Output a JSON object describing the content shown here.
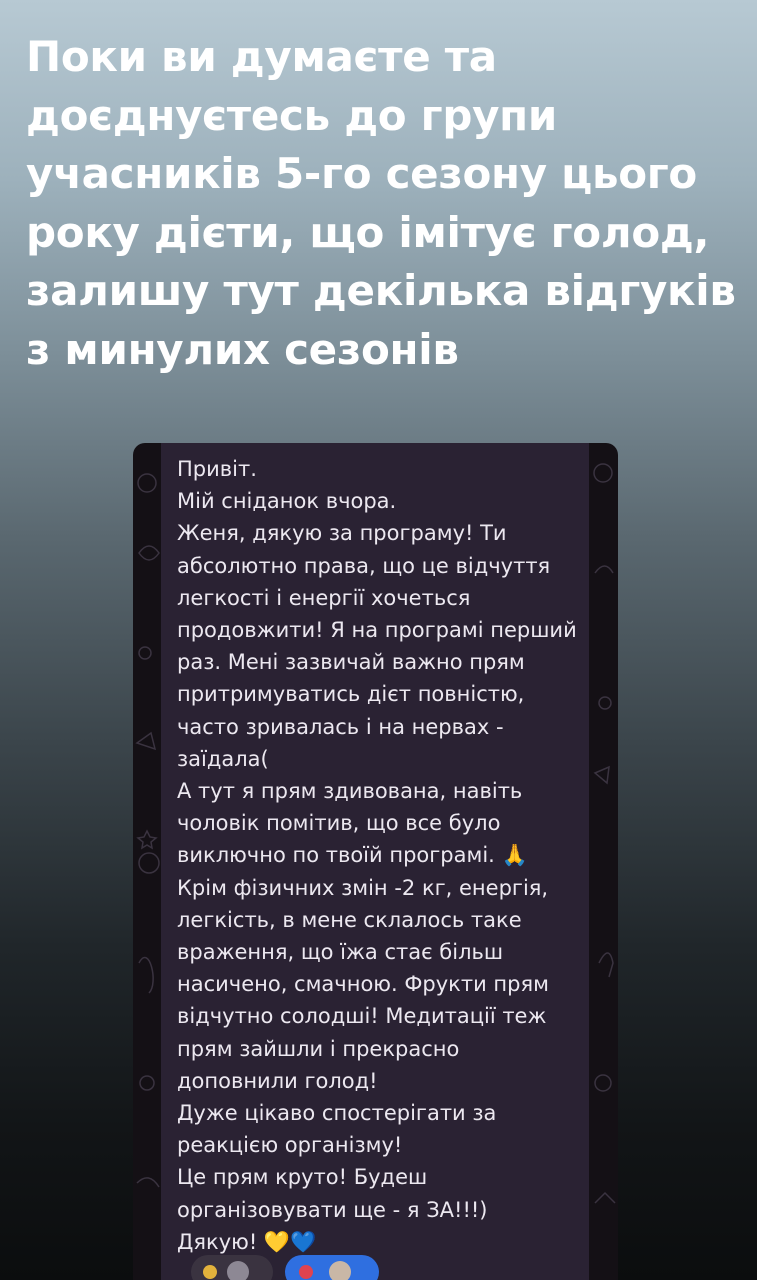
{
  "story": {
    "caption": "Поки ви думаєте та доєднуєтесь до групи учасників 5-го сезону цього року дієти, що імітує голод, залишу тут декілька відгуків з минулих сезонів"
  },
  "message": {
    "text": "Привіт.\nМій сніданок вчора.\nЖеня, дякую за програму! Ти абсолютно права, що це відчуття легкості і енергії хочеться продовжити! Я на програмі перший раз. Мені зазвичай важно прям притримуватись дієт повністю, часто зривалась і на нервах - заїдала(\nА тут я прям здивована, навіть чоловік помітив, що все було виключно по твоїй програмі. 🙏\nКрім фізичних змін -2 кг, енергія, легкість, в мене склалось таке враження, що їжа стає більш насичено, смачною. Фрукти прям відчутно солодші! Медитації теж прям зайшли і прекрасно доповнили голод!\nДуже цікаво спостерігати за реакцією організму!\nЦе прям круто! Будеш організовувати ще - я ЗА!!!)\nДякую! 💛💙"
  },
  "colors": {
    "bubble": "#2a2233",
    "wallpaper": "#141015",
    "text": "#ece8f0",
    "reaction_highlight": "#2f6fe0"
  }
}
